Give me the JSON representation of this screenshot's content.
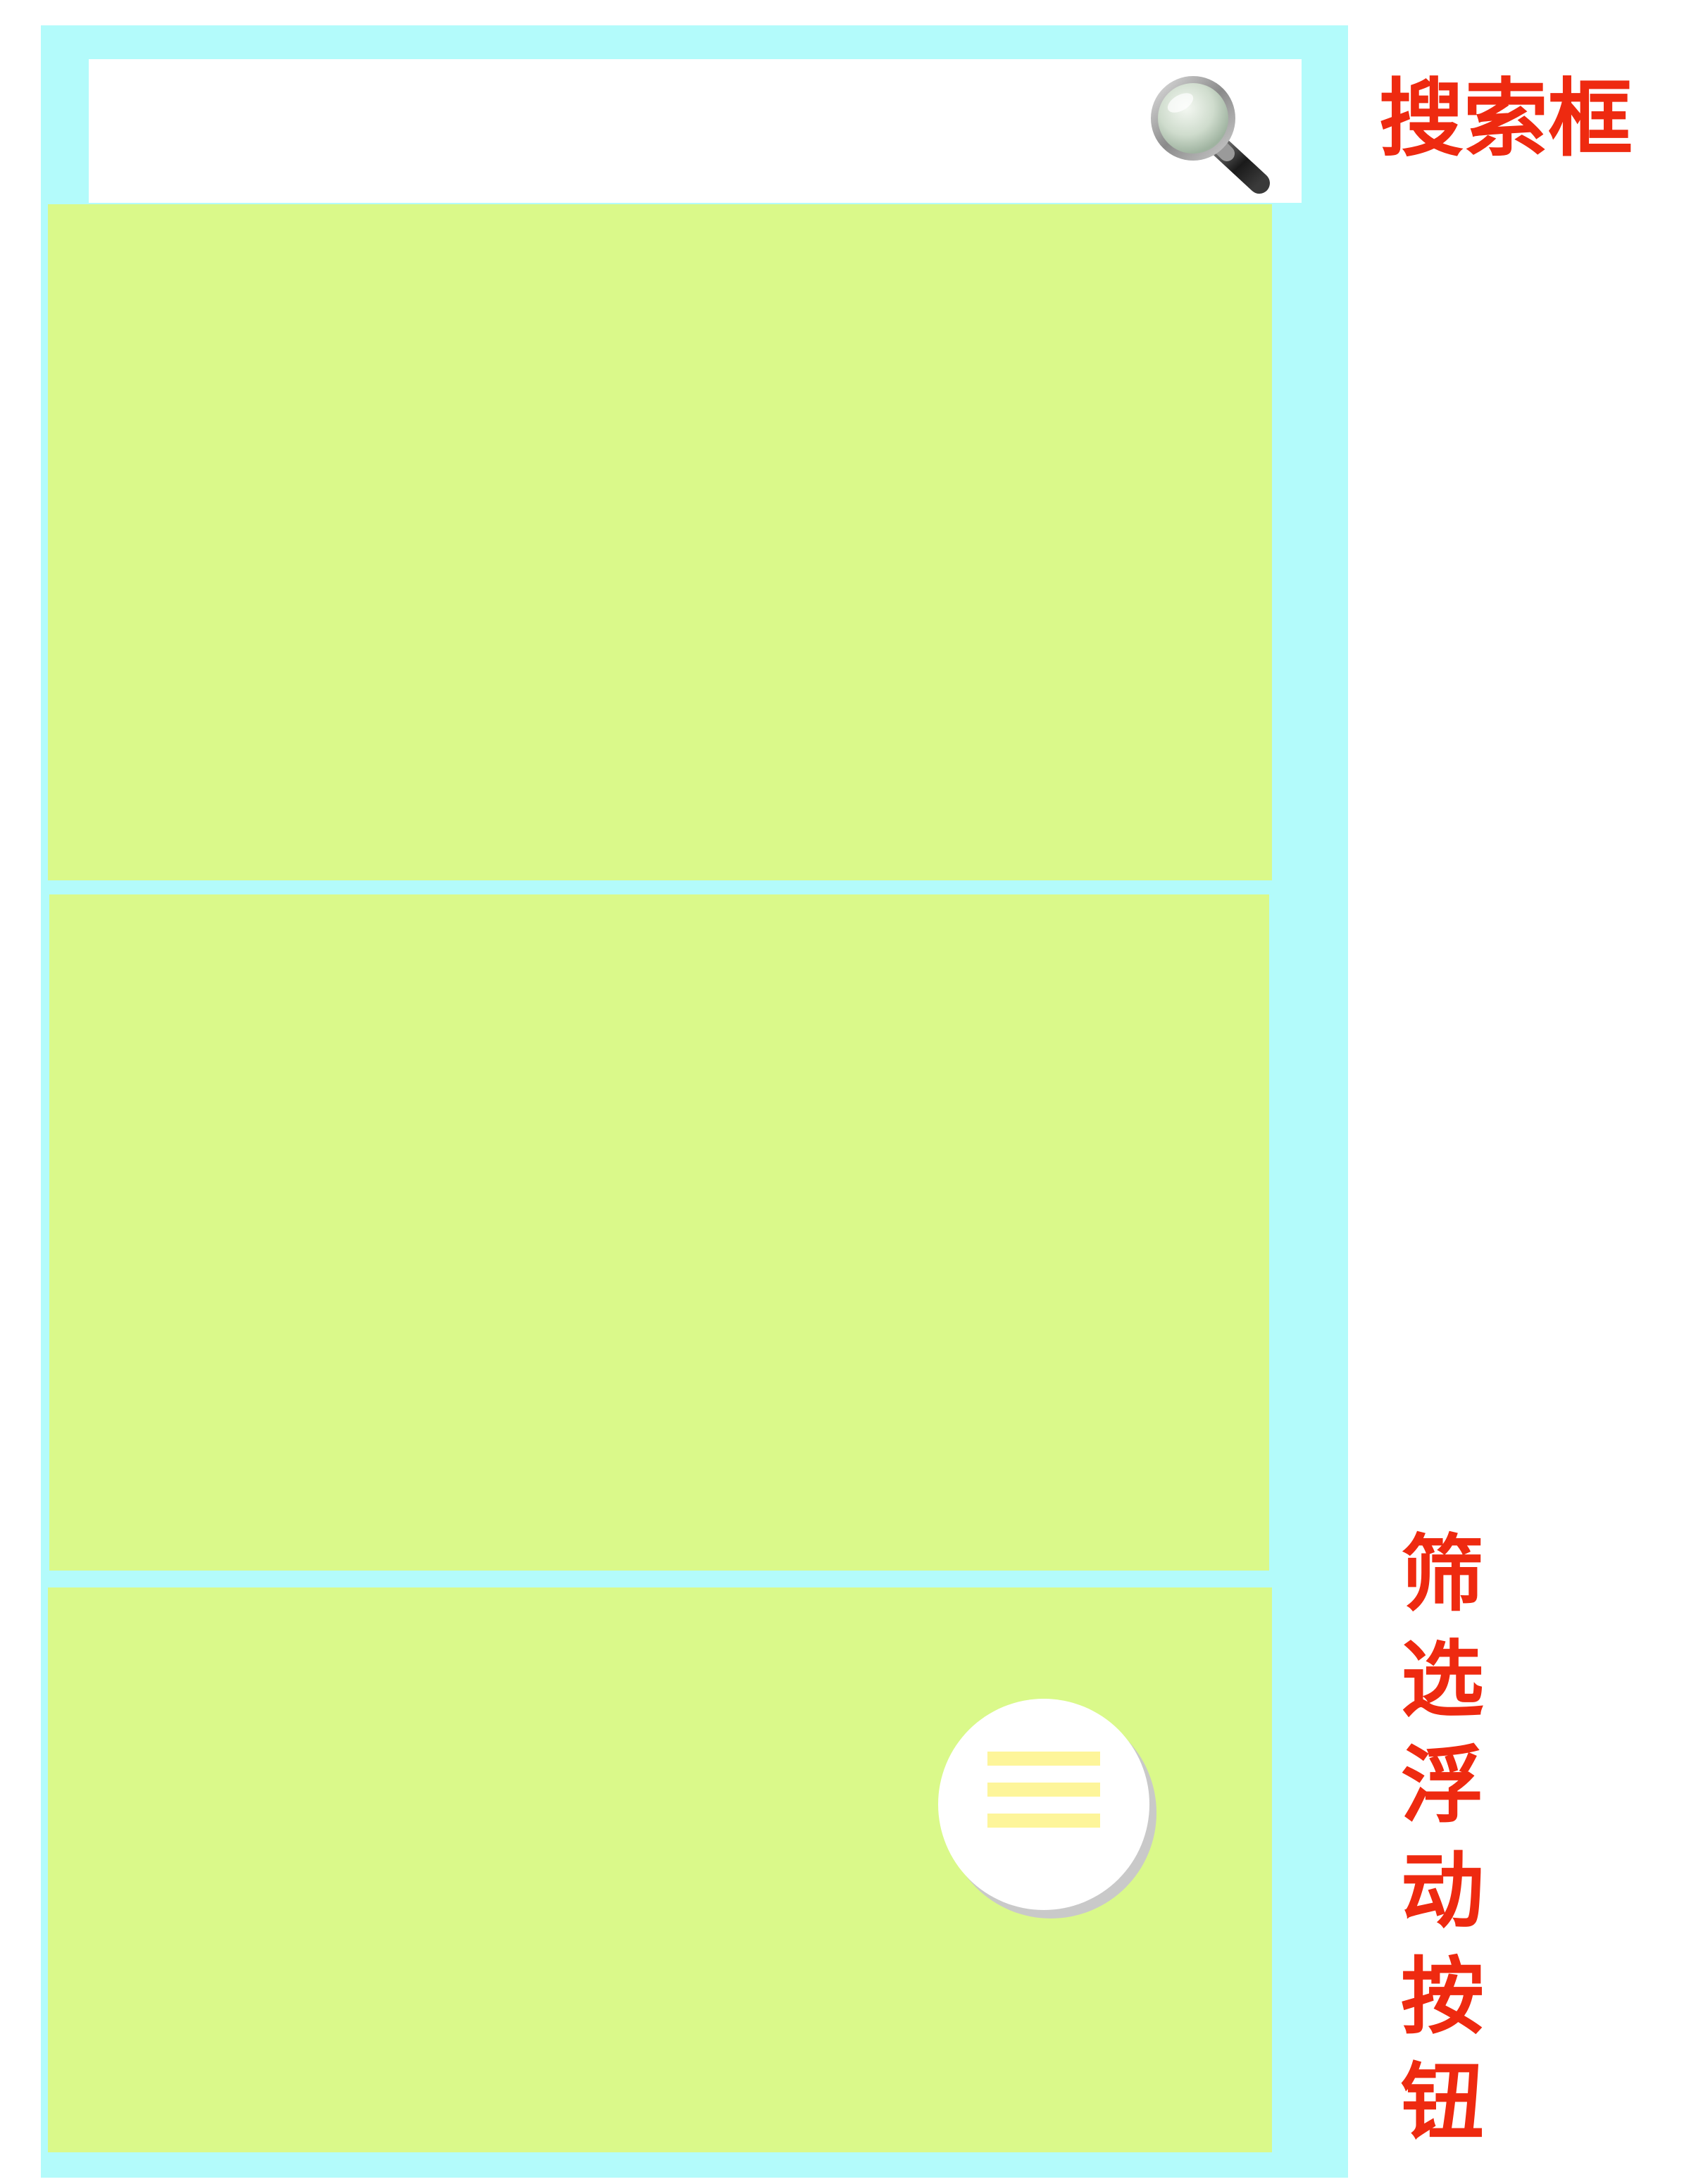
{
  "search": {
    "value": "",
    "placeholder": "",
    "icon": "magnifying-glass-icon"
  },
  "content": {
    "cards": [
      {
        "color": "#daf98a"
      },
      {
        "color": "#daf98a"
      },
      {
        "color": "#daf98a"
      }
    ]
  },
  "fab": {
    "icon": "menu-icon",
    "line_color": "#fdf59a"
  },
  "annotations": {
    "search_box": "搜索框",
    "filter_fab": "筛选浮动按钮"
  },
  "colors": {
    "frame": "#b3fbfb",
    "card": "#daf98a",
    "annotation": "#ee2a10"
  }
}
